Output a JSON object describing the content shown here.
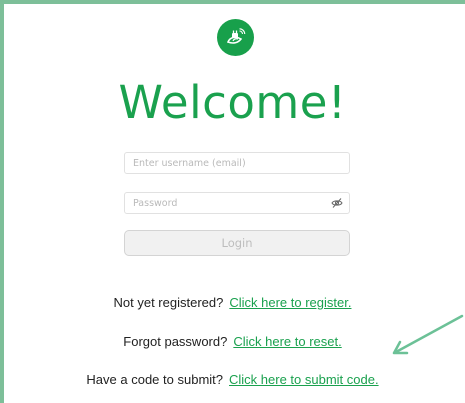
{
  "colors": {
    "brand_green": "#1aa14e",
    "frame_green": "#7dbf99",
    "arrow_green": "#6cc197"
  },
  "logo": {
    "icon": "plant-plug-icon"
  },
  "header": {
    "title": "Welcome!"
  },
  "form": {
    "username_placeholder": "Enter username (email)",
    "password_placeholder": "Password",
    "password_toggle_icon": "eye-slash-icon",
    "login_label": "Login"
  },
  "links": {
    "register_prompt": "Not yet registered?",
    "register_link": "Click here to register.",
    "forgot_prompt": "Forgot password?",
    "forgot_link": "Click here to reset.",
    "code_prompt": "Have a code to submit?",
    "code_link": "Click here to submit code."
  },
  "annotation": {
    "icon": "arrow-annotation-icon"
  }
}
